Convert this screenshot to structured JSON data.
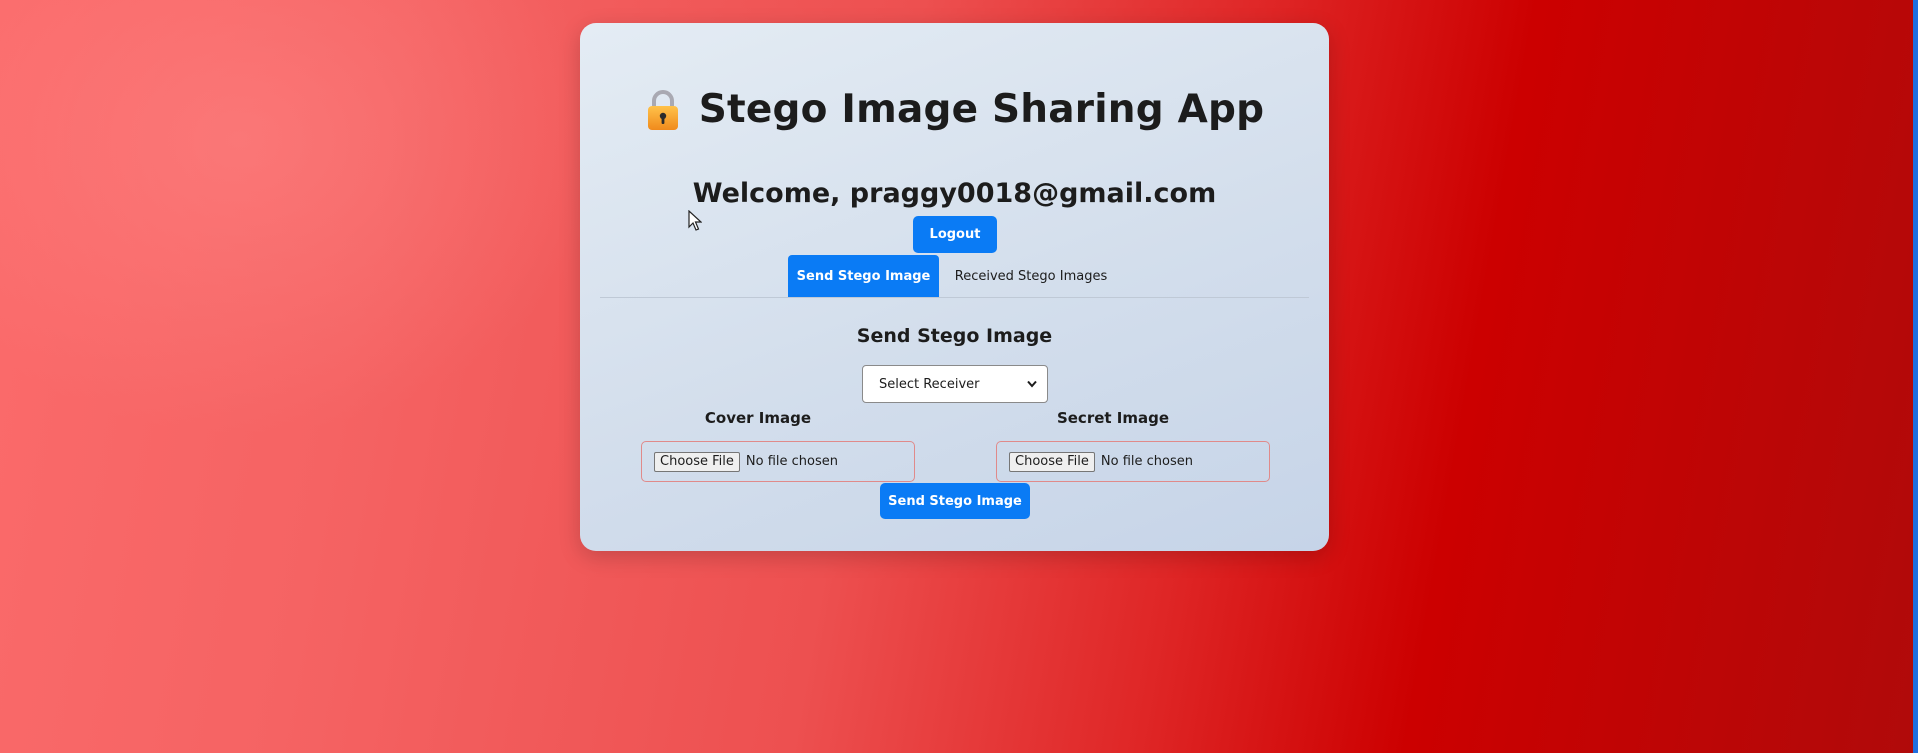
{
  "app": {
    "title": "Stego Image Sharing App",
    "title_icon": "lock-icon"
  },
  "user": {
    "welcome_text": "Welcome, praggy0018@gmail.com",
    "logout_label": "Logout"
  },
  "tabs": [
    {
      "label": "Send Stego Image",
      "active": true
    },
    {
      "label": "Received Stego Images",
      "active": false
    }
  ],
  "send_form": {
    "section_title": "Send Stego Image",
    "receiver_select": {
      "selected": "Select Receiver"
    },
    "cover_image": {
      "label": "Cover Image",
      "button": "Choose File",
      "status": "No file chosen"
    },
    "secret_image": {
      "label": "Secret Image",
      "button": "Choose File",
      "status": "No file chosen"
    },
    "submit_label": "Send Stego Image"
  },
  "colors": {
    "accent": "#0a7bf5",
    "background_start": "#fb6b6b",
    "background_end": "#b00a0a"
  }
}
